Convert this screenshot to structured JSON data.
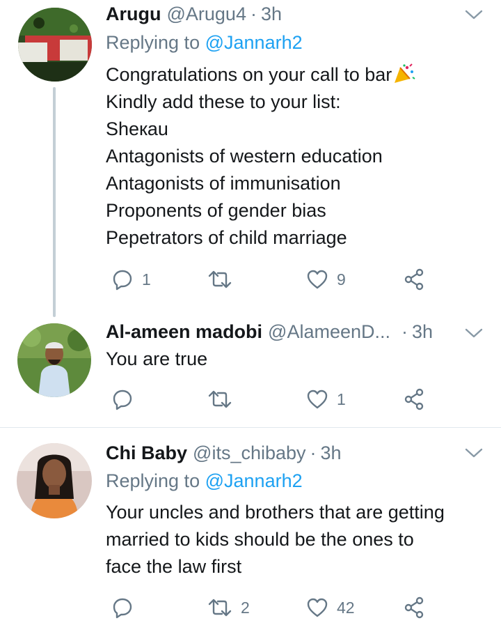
{
  "tweets": [
    {
      "name": "Arugu",
      "handle": "@Arugu4",
      "dot": "·",
      "time": "3h",
      "replying_prefix": "Replying to",
      "replying_to": "@Jannarh2",
      "lines": [
        "Congratulations on your call to bar",
        "Kindly add these to your list:",
        "Shекau",
        "Antagonists of western education",
        "Antagonists of immunisation",
        "Proponents of gender bias",
        "Pepetrators of child marriage"
      ],
      "emoji": "party-popper-icon",
      "replies": "1",
      "retweets": "",
      "likes": "9"
    },
    {
      "name": "Al-ameen madobi",
      "handle": "@AlameenD...",
      "dot": "·",
      "time": "3h",
      "lines": [
        "You are true"
      ],
      "replies": "",
      "retweets": "",
      "likes": "1"
    },
    {
      "name": "Chi Baby",
      "handle": "@its_chibaby",
      "dot": "·",
      "time": "3h",
      "replying_prefix": "Replying to",
      "replying_to": "@Jannarh2",
      "lines": [
        "Your uncles and brothers that are getting",
        "married to kids should be the ones to",
        "face the law first"
      ],
      "replies": "",
      "retweets": "2",
      "likes": "42"
    }
  ],
  "icons": {
    "reply": "reply-icon",
    "retweet": "retweet-icon",
    "like": "heart-icon",
    "share": "share-icon",
    "menu": "chevron-down-icon"
  },
  "colors": {
    "text": "#14171a",
    "muted": "#657786",
    "link": "#1da1f2",
    "divider": "#e1e8ed",
    "thread": "#c4cfd6"
  }
}
